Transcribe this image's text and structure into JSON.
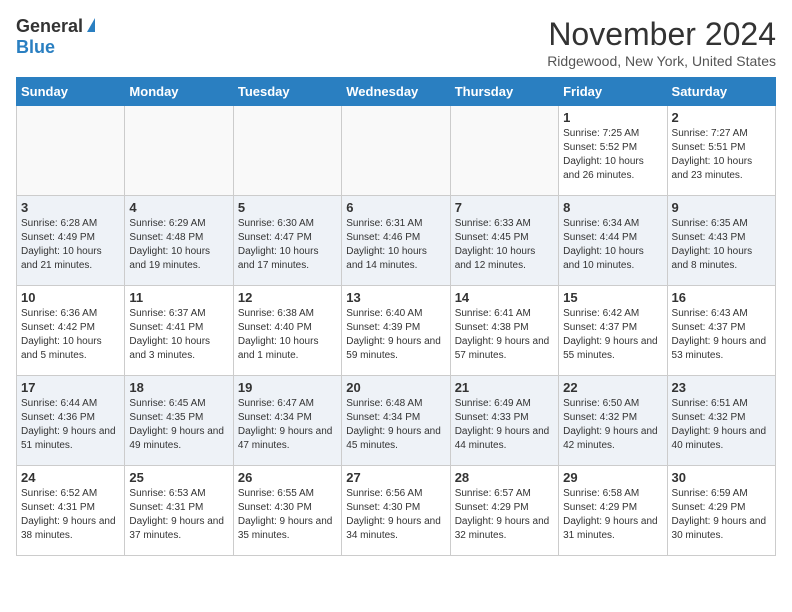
{
  "logo": {
    "general": "General",
    "blue": "Blue"
  },
  "title": "November 2024",
  "location": "Ridgewood, New York, United States",
  "days_of_week": [
    "Sunday",
    "Monday",
    "Tuesday",
    "Wednesday",
    "Thursday",
    "Friday",
    "Saturday"
  ],
  "weeks": [
    {
      "shaded": false,
      "days": [
        {
          "date": "",
          "info": ""
        },
        {
          "date": "",
          "info": ""
        },
        {
          "date": "",
          "info": ""
        },
        {
          "date": "",
          "info": ""
        },
        {
          "date": "",
          "info": ""
        },
        {
          "date": "1",
          "info": "Sunrise: 7:25 AM\nSunset: 5:52 PM\nDaylight: 10 hours and 26 minutes."
        },
        {
          "date": "2",
          "info": "Sunrise: 7:27 AM\nSunset: 5:51 PM\nDaylight: 10 hours and 23 minutes."
        }
      ]
    },
    {
      "shaded": true,
      "days": [
        {
          "date": "3",
          "info": "Sunrise: 6:28 AM\nSunset: 4:49 PM\nDaylight: 10 hours and 21 minutes."
        },
        {
          "date": "4",
          "info": "Sunrise: 6:29 AM\nSunset: 4:48 PM\nDaylight: 10 hours and 19 minutes."
        },
        {
          "date": "5",
          "info": "Sunrise: 6:30 AM\nSunset: 4:47 PM\nDaylight: 10 hours and 17 minutes."
        },
        {
          "date": "6",
          "info": "Sunrise: 6:31 AM\nSunset: 4:46 PM\nDaylight: 10 hours and 14 minutes."
        },
        {
          "date": "7",
          "info": "Sunrise: 6:33 AM\nSunset: 4:45 PM\nDaylight: 10 hours and 12 minutes."
        },
        {
          "date": "8",
          "info": "Sunrise: 6:34 AM\nSunset: 4:44 PM\nDaylight: 10 hours and 10 minutes."
        },
        {
          "date": "9",
          "info": "Sunrise: 6:35 AM\nSunset: 4:43 PM\nDaylight: 10 hours and 8 minutes."
        }
      ]
    },
    {
      "shaded": false,
      "days": [
        {
          "date": "10",
          "info": "Sunrise: 6:36 AM\nSunset: 4:42 PM\nDaylight: 10 hours and 5 minutes."
        },
        {
          "date": "11",
          "info": "Sunrise: 6:37 AM\nSunset: 4:41 PM\nDaylight: 10 hours and 3 minutes."
        },
        {
          "date": "12",
          "info": "Sunrise: 6:38 AM\nSunset: 4:40 PM\nDaylight: 10 hours and 1 minute."
        },
        {
          "date": "13",
          "info": "Sunrise: 6:40 AM\nSunset: 4:39 PM\nDaylight: 9 hours and 59 minutes."
        },
        {
          "date": "14",
          "info": "Sunrise: 6:41 AM\nSunset: 4:38 PM\nDaylight: 9 hours and 57 minutes."
        },
        {
          "date": "15",
          "info": "Sunrise: 6:42 AM\nSunset: 4:37 PM\nDaylight: 9 hours and 55 minutes."
        },
        {
          "date": "16",
          "info": "Sunrise: 6:43 AM\nSunset: 4:37 PM\nDaylight: 9 hours and 53 minutes."
        }
      ]
    },
    {
      "shaded": true,
      "days": [
        {
          "date": "17",
          "info": "Sunrise: 6:44 AM\nSunset: 4:36 PM\nDaylight: 9 hours and 51 minutes."
        },
        {
          "date": "18",
          "info": "Sunrise: 6:45 AM\nSunset: 4:35 PM\nDaylight: 9 hours and 49 minutes."
        },
        {
          "date": "19",
          "info": "Sunrise: 6:47 AM\nSunset: 4:34 PM\nDaylight: 9 hours and 47 minutes."
        },
        {
          "date": "20",
          "info": "Sunrise: 6:48 AM\nSunset: 4:34 PM\nDaylight: 9 hours and 45 minutes."
        },
        {
          "date": "21",
          "info": "Sunrise: 6:49 AM\nSunset: 4:33 PM\nDaylight: 9 hours and 44 minutes."
        },
        {
          "date": "22",
          "info": "Sunrise: 6:50 AM\nSunset: 4:32 PM\nDaylight: 9 hours and 42 minutes."
        },
        {
          "date": "23",
          "info": "Sunrise: 6:51 AM\nSunset: 4:32 PM\nDaylight: 9 hours and 40 minutes."
        }
      ]
    },
    {
      "shaded": false,
      "days": [
        {
          "date": "24",
          "info": "Sunrise: 6:52 AM\nSunset: 4:31 PM\nDaylight: 9 hours and 38 minutes."
        },
        {
          "date": "25",
          "info": "Sunrise: 6:53 AM\nSunset: 4:31 PM\nDaylight: 9 hours and 37 minutes."
        },
        {
          "date": "26",
          "info": "Sunrise: 6:55 AM\nSunset: 4:30 PM\nDaylight: 9 hours and 35 minutes."
        },
        {
          "date": "27",
          "info": "Sunrise: 6:56 AM\nSunset: 4:30 PM\nDaylight: 9 hours and 34 minutes."
        },
        {
          "date": "28",
          "info": "Sunrise: 6:57 AM\nSunset: 4:29 PM\nDaylight: 9 hours and 32 minutes."
        },
        {
          "date": "29",
          "info": "Sunrise: 6:58 AM\nSunset: 4:29 PM\nDaylight: 9 hours and 31 minutes."
        },
        {
          "date": "30",
          "info": "Sunrise: 6:59 AM\nSunset: 4:29 PM\nDaylight: 9 hours and 30 minutes."
        }
      ]
    }
  ]
}
